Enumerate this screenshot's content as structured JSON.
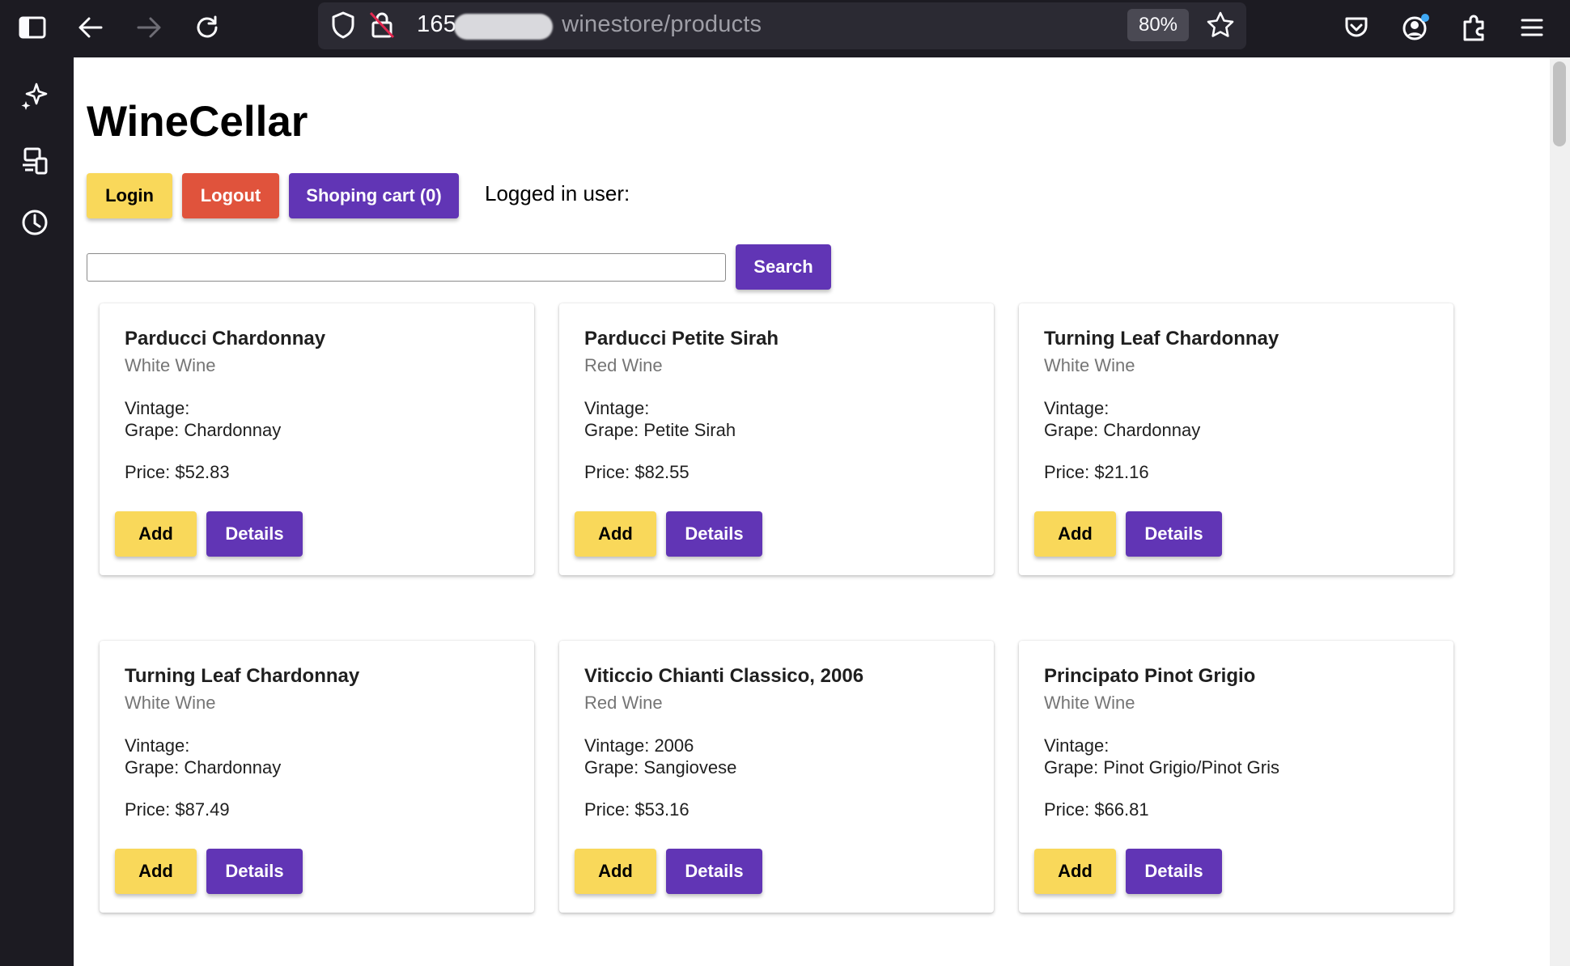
{
  "browser": {
    "url_host": "165.",
    "url_path": "winestore/products",
    "zoom": "80%"
  },
  "page": {
    "brand": "WineCellar",
    "login_label": "Login",
    "logout_label": "Logout",
    "cart_label": "Shoping cart (0)",
    "logged_in_label": "Logged in user:",
    "search_value": "",
    "search_button": "Search"
  },
  "products": [
    {
      "name": "Parducci Chardonnay",
      "type": "White Wine",
      "vintage": "Vintage:",
      "grape": "Grape: Chardonnay",
      "price": "Price: $52.83",
      "add": "Add",
      "details": "Details"
    },
    {
      "name": "Parducci Petite Sirah",
      "type": "Red Wine",
      "vintage": "Vintage:",
      "grape": "Grape: Petite Sirah",
      "price": "Price: $82.55",
      "add": "Add",
      "details": "Details"
    },
    {
      "name": "Turning Leaf Chardonnay",
      "type": "White Wine",
      "vintage": "Vintage:",
      "grape": "Grape: Chardonnay",
      "price": "Price: $21.16",
      "add": "Add",
      "details": "Details"
    },
    {
      "name": "Turning Leaf Chardonnay",
      "type": "White Wine",
      "vintage": "Vintage:",
      "grape": "Grape: Chardonnay",
      "price": "Price: $87.49",
      "add": "Add",
      "details": "Details"
    },
    {
      "name": "Viticcio Chianti Classico, 2006",
      "type": "Red Wine",
      "vintage": "Vintage: 2006",
      "grape": "Grape: Sangiovese",
      "price": "Price: $53.16",
      "add": "Add",
      "details": "Details"
    },
    {
      "name": "Principato Pinot Grigio",
      "type": "White Wine",
      "vintage": "Vintage:",
      "grape": "Grape: Pinot Grigio/Pinot Gris",
      "price": "Price: $66.81",
      "add": "Add",
      "details": "Details"
    }
  ],
  "colors": {
    "yellow_button": "#f9d85a",
    "red_button": "#e0533c",
    "purple_button": "#6135b5",
    "chrome_dark": "#1c1b22"
  }
}
